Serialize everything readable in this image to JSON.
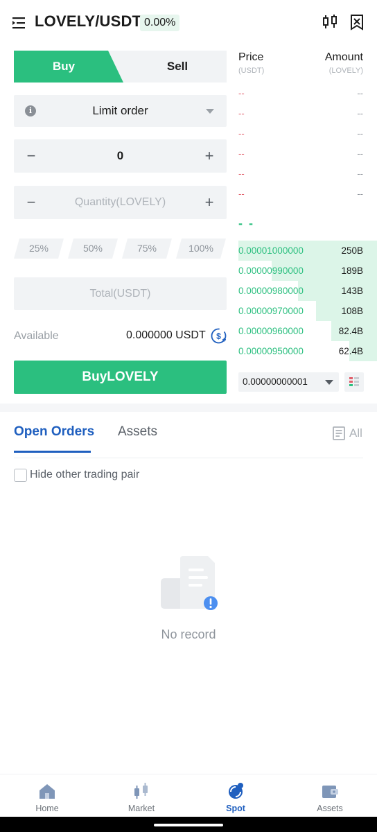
{
  "header": {
    "pair": "LOVELY/USDT",
    "change": "0.00%"
  },
  "trade": {
    "buy_tab": "Buy",
    "sell_tab": "Sell",
    "order_type": "Limit order",
    "price_value": "0",
    "quantity_placeholder": "Quantity(LOVELY)",
    "percent_options": [
      "25%",
      "50%",
      "75%",
      "100%"
    ],
    "total_placeholder": "Total(USDT)",
    "available_label": "Available",
    "available_value": "0.000000 USDT",
    "buy_button": "BuyLOVELY"
  },
  "order_book": {
    "price_header": "Price",
    "price_unit": "(USDT)",
    "amount_header": "Amount",
    "amount_unit": "(LOVELY)",
    "asks": [
      {
        "price": "--",
        "amount": "--"
      },
      {
        "price": "--",
        "amount": "--"
      },
      {
        "price": "--",
        "amount": "--"
      },
      {
        "price": "--",
        "amount": "--"
      },
      {
        "price": "--",
        "amount": "--"
      },
      {
        "price": "--",
        "amount": "--"
      }
    ],
    "last_price": "- -",
    "bids": [
      {
        "price": "0.00001000000",
        "amount": "250B",
        "depth": 1.0
      },
      {
        "price": "0.00000990000",
        "amount": "189B",
        "depth": 0.76
      },
      {
        "price": "0.00000980000",
        "amount": "143B",
        "depth": 0.57
      },
      {
        "price": "0.00000970000",
        "amount": "108B",
        "depth": 0.44
      },
      {
        "price": "0.00000960000",
        "amount": "82.4B",
        "depth": 0.33
      },
      {
        "price": "0.00000950000",
        "amount": "62.4B",
        "depth": 0.2
      }
    ],
    "precision": "0.00000000001",
    "colors": {
      "ask": "#e15e6a",
      "bid": "#2bbf7f"
    }
  },
  "orders": {
    "tab_open": "Open Orders",
    "tab_assets": "Assets",
    "all_label": "All",
    "hide_label": "Hide other trading pair",
    "empty_text": "No record"
  },
  "nav": {
    "items": [
      {
        "label": "Home",
        "icon": "home-icon"
      },
      {
        "label": "Market",
        "icon": "market-icon"
      },
      {
        "label": "Spot",
        "icon": "spot-icon"
      },
      {
        "label": "Assets",
        "icon": "wallet-icon"
      }
    ],
    "active": "Spot"
  },
  "colors": {
    "accent": "#2bbf7f",
    "link": "#1f5fbf"
  }
}
